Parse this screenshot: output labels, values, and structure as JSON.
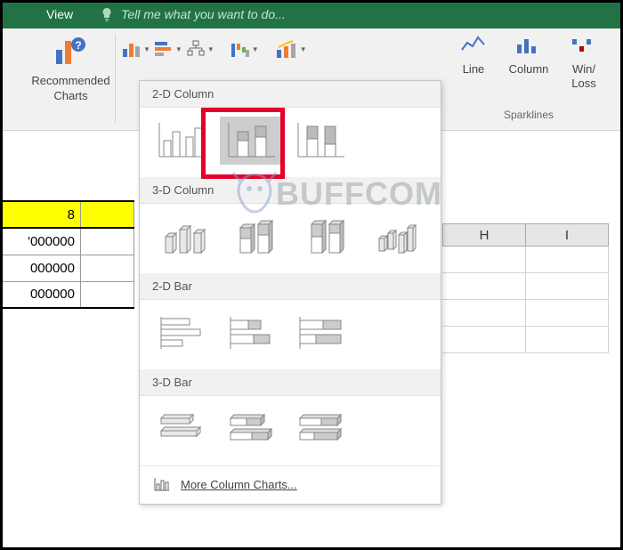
{
  "titlebar": {
    "tab": "View",
    "tell_me": "Tell me what you want to do..."
  },
  "ribbon": {
    "recommended_charts": "Recommended\nCharts",
    "sparklines_label": "Sparklines",
    "spark_line": "Line",
    "spark_column": "Column",
    "spark_winloss": "Win/\nLoss"
  },
  "dropdown": {
    "sec_2d_column": "2-D Column",
    "sec_3d_column": "3-D Column",
    "sec_2d_bar": "2-D Bar",
    "sec_3d_bar": "3-D Bar",
    "more": "More Column Charts..."
  },
  "sheet": {
    "col_h": "H",
    "col_i": "I",
    "r1c1": "8",
    "r2c1": "'000000",
    "r3c1": "000000",
    "r4c1": "000000"
  },
  "watermark": {
    "text": "BUFFCOM"
  }
}
